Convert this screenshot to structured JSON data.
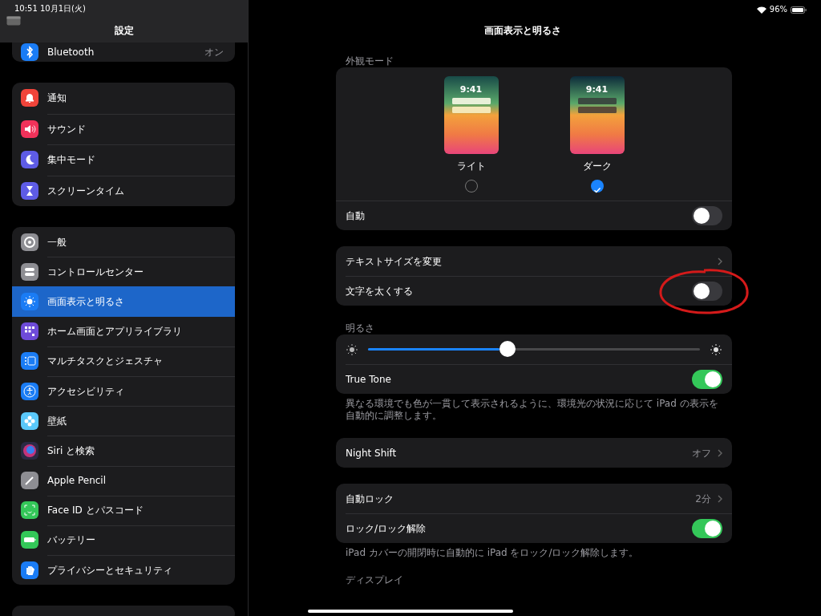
{
  "status_bar": {
    "time": "10:51",
    "date": "10月1日(火)",
    "battery": "96%"
  },
  "sidebar": {
    "title": "設定",
    "groups": [
      {
        "items": [
          {
            "label": "Bluetooth",
            "value": "オン",
            "color": "#1a7cf5",
            "selected": false
          }
        ]
      },
      {
        "items": [
          {
            "label": "通知",
            "color": "#f0443a",
            "selected": false
          },
          {
            "label": "サウンド",
            "color": "#f0325a",
            "selected": false
          },
          {
            "label": "集中モード",
            "color": "#5e5ce6",
            "selected": false
          },
          {
            "label": "スクリーンタイム",
            "color": "#5e5ce6",
            "selected": false
          }
        ]
      },
      {
        "items": [
          {
            "label": "一般",
            "color": "#8e8e93",
            "selected": false
          },
          {
            "label": "コントロールセンター",
            "color": "#8e8e93",
            "selected": false
          },
          {
            "label": "画面表示と明るさ",
            "color": "#1a7cf5",
            "selected": true
          },
          {
            "label": "ホーム画面とアプリライブラリ",
            "color": "#6e4bd8",
            "selected": false
          },
          {
            "label": "マルチタスクとジェスチャ",
            "color": "#1a7cf5",
            "selected": false
          },
          {
            "label": "アクセシビリティ",
            "color": "#1a7cf5",
            "selected": false
          },
          {
            "label": "壁紙",
            "color": "#5ac8fa",
            "selected": false
          },
          {
            "label": "Siri と検索",
            "color": "#2a2a44",
            "selected": false
          },
          {
            "label": "Apple Pencil",
            "color": "#8e8e93",
            "selected": false
          },
          {
            "label": "Face ID とパスコード",
            "color": "#34c759",
            "selected": false
          },
          {
            "label": "バッテリー",
            "color": "#34c759",
            "selected": false
          },
          {
            "label": "プライバシーとセキュリティ",
            "color": "#1a7cf5",
            "selected": false
          }
        ]
      }
    ]
  },
  "detail": {
    "title": "画面表示と明るさ",
    "sections": [
      {
        "header": "外観モード",
        "options": [
          {
            "label": "ライト",
            "time": "9:41",
            "kind": "light",
            "selected": false
          },
          {
            "label": "ダーク",
            "time": "9:41",
            "kind": "dark",
            "selected": true
          }
        ],
        "rows": [
          {
            "kind": "toggle",
            "label": "自動",
            "on": false
          }
        ]
      },
      {
        "rows": [
          {
            "kind": "link",
            "label": "テキストサイズを変更"
          },
          {
            "kind": "toggle",
            "label": "文字を太くする",
            "on": false
          }
        ]
      },
      {
        "header": "明るさ",
        "rows": [
          {
            "kind": "slider",
            "level": 0.42
          },
          {
            "kind": "toggle",
            "label": "True Tone",
            "on": true
          }
        ],
        "footer": "異なる環境でも色が一貫して表示されるように、環境光の状況に応じて iPad の表示を自動的に調整します。"
      },
      {
        "rows": [
          {
            "kind": "link",
            "label": "Night Shift",
            "value": "オフ"
          }
        ]
      },
      {
        "rows": [
          {
            "kind": "link",
            "label": "自動ロック",
            "value": "2分"
          },
          {
            "kind": "toggle",
            "label": "ロック/ロック解除",
            "on": true
          }
        ],
        "footer": "iPad カバーの開閉時に自動的に iPad をロック/ロック解除します。"
      },
      {
        "header": "ディスプレイ"
      }
    ]
  }
}
